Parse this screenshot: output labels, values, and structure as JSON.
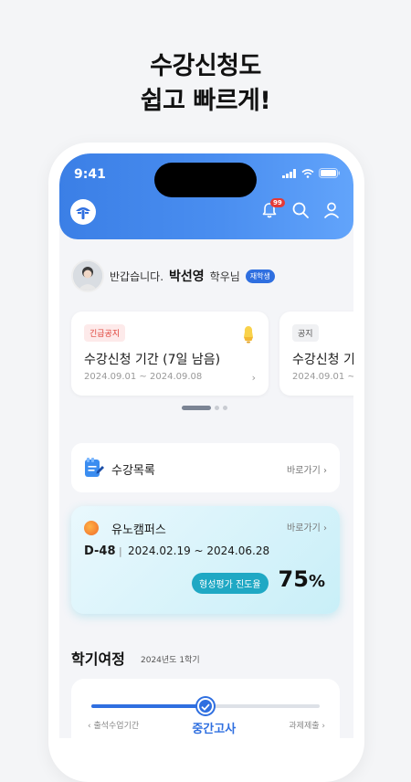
{
  "hero": {
    "line1": "수강신청도",
    "line2": "쉽고 빠르게!"
  },
  "status_bar": {
    "time": "9:41"
  },
  "header": {
    "notification_count": "99"
  },
  "greeting": {
    "prefix": "반갑습니다.",
    "name": "박선영",
    "suffix": "학우님",
    "status": "재학생"
  },
  "notices": [
    {
      "tag": "긴급공지",
      "title": "수강신청 기간 (7일 남음)",
      "date": "2024.09.01 ~ 2024.09.08"
    },
    {
      "tag": "공지",
      "title": "수강신청 기",
      "date": "2024.09.01 ~ 2"
    }
  ],
  "course_list": {
    "title": "수강목록",
    "link": "바로가기 ›"
  },
  "campus": {
    "title": "유노캠퍼스",
    "link": "바로가기 ›",
    "dday": "D-48",
    "separator": "|",
    "range": "2024.02.19 ~ 2024.06.28",
    "progress_label": "형성평가 진도율",
    "progress_value": "75",
    "progress_unit": "%"
  },
  "journey": {
    "title": "학기여정",
    "term": "2024년도 1학기",
    "progress": 0.5,
    "label_left": "‹ 출석수업기간",
    "label_mid": "중간고사",
    "label_right": "과제제출 ›"
  },
  "colors": {
    "primary": "#2f6fe0",
    "alert": "#e53935",
    "accent": "#1fa8c4"
  }
}
